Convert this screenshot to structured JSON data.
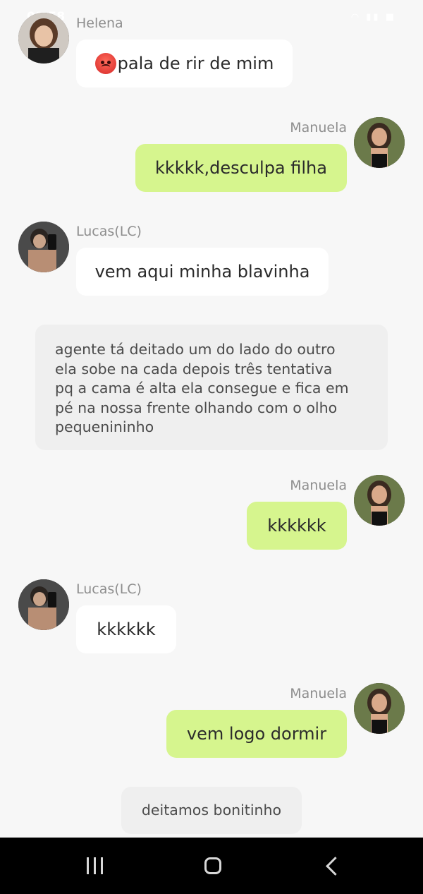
{
  "status_bar": {
    "time": "09:58",
    "icons": "wifi signal battery"
  },
  "messages": [
    {
      "id": "m1",
      "sender": "Helena",
      "side": "left",
      "text": "pala de rir de mim",
      "emoji": "angry-face"
    },
    {
      "id": "m2",
      "sender": "Manuela",
      "side": "right",
      "text": "kkkkk,desculpa filha"
    },
    {
      "id": "m3",
      "sender": "Lucas(LC)",
      "side": "left",
      "text": "vem aqui minha blavinha"
    },
    {
      "id": "m4",
      "type": "narration",
      "text": "agente tá deitado um do lado do outro\nela sobe na cada depois três tentativa\npq a cama é alta ela consegue e fica em\npé na nossa frente olhando com o olho\npequenininho"
    },
    {
      "id": "m5",
      "sender": "Manuela",
      "side": "right",
      "text": "kkkkkk"
    },
    {
      "id": "m6",
      "sender": "Lucas(LC)",
      "side": "left",
      "text": "kkkkkk"
    },
    {
      "id": "m7",
      "sender": "Manuela",
      "side": "right",
      "text": "vem logo dormir"
    },
    {
      "id": "m8",
      "type": "narration",
      "text": "deitamos bonitinho"
    }
  ],
  "nav_bar": {
    "buttons": [
      "recents-icon",
      "home-icon",
      "back-icon"
    ]
  },
  "colors": {
    "right_bubble": "#d6f58e",
    "left_bubble": "#ffffff",
    "narration_bg": "#efefef",
    "background": "#f7f7f7"
  }
}
